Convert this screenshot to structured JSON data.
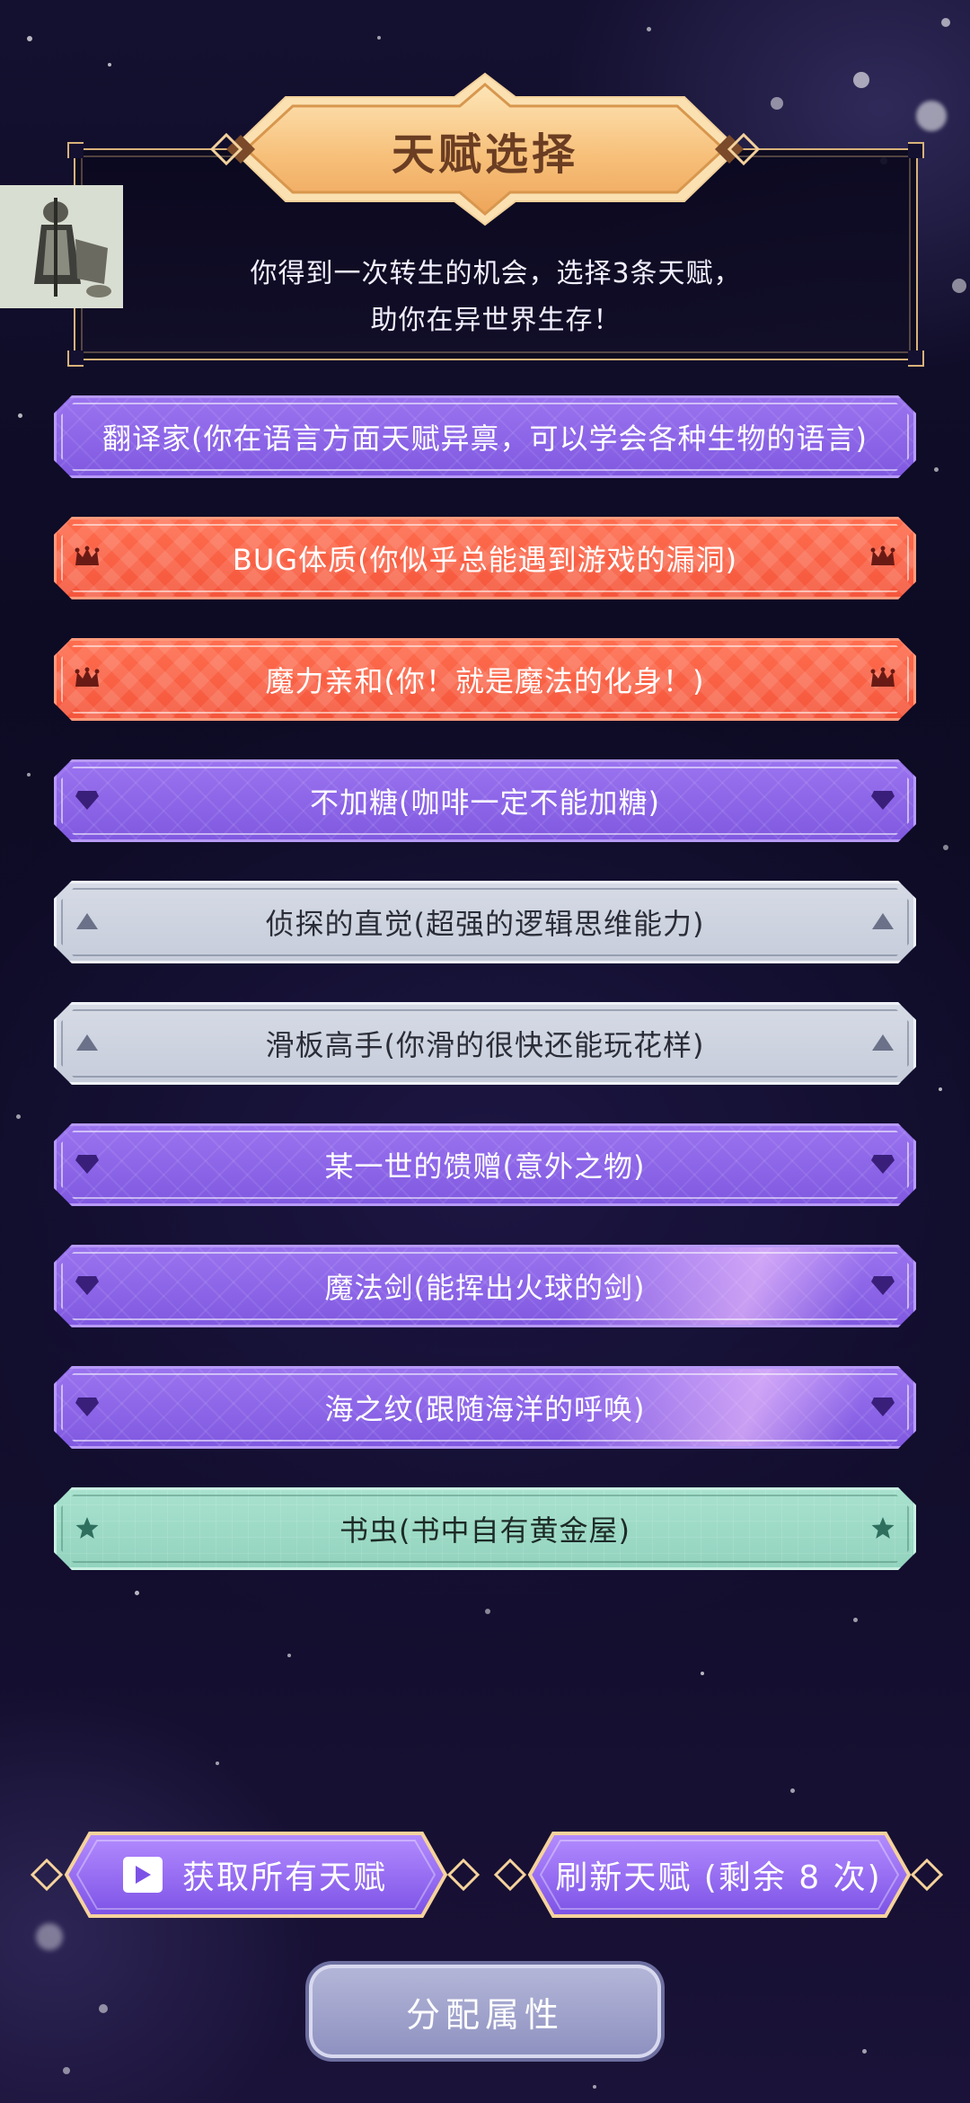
{
  "header": {
    "title": "天赋选择",
    "subtitle_line1": "你得到一次转生的机会，选择3条天赋，",
    "subtitle_line2": "助你在异世界生存！"
  },
  "talents": [
    {
      "label": "翻译家(你在语言方面天赋异禀，可以学会各种生物的语言)",
      "rarity": "purple",
      "icon": "none"
    },
    {
      "label": "BUG体质(你似乎总能遇到游戏的漏洞)",
      "rarity": "orange",
      "icon": "crown-icon"
    },
    {
      "label": "魔力亲和(你！就是魔法的化身！)",
      "rarity": "orange",
      "icon": "crown-icon"
    },
    {
      "label": "不加糖(咖啡一定不能加糖)",
      "rarity": "purple",
      "icon": "diamond-icon"
    },
    {
      "label": "侦探的直觉(超强的逻辑思维能力)",
      "rarity": "gray",
      "icon": "triangle-icon"
    },
    {
      "label": "滑板高手(你滑的很快还能玩花样)",
      "rarity": "gray",
      "icon": "triangle-icon"
    },
    {
      "label": "某一世的馈赠(意外之物)",
      "rarity": "purple",
      "icon": "diamond-icon"
    },
    {
      "label": "魔法剑(能挥出火球的剑)",
      "rarity": "purple",
      "icon": "diamond-icon"
    },
    {
      "label": "海之纹(跟随海洋的呼唤)",
      "rarity": "purple",
      "icon": "diamond-icon"
    },
    {
      "label": "书虫(书中自有黄金屋)",
      "rarity": "green",
      "icon": "star-icon"
    }
  ],
  "buttons": {
    "get_all": "获取所有天赋",
    "refresh": "刷新天赋 (剩余 8 次)",
    "assign": "分配属性"
  },
  "colors": {
    "purple": "#8a63e8",
    "orange": "#f65c40",
    "gray": "#cdd2de",
    "green": "#9fdcc8",
    "gold": "#f7c98a"
  }
}
